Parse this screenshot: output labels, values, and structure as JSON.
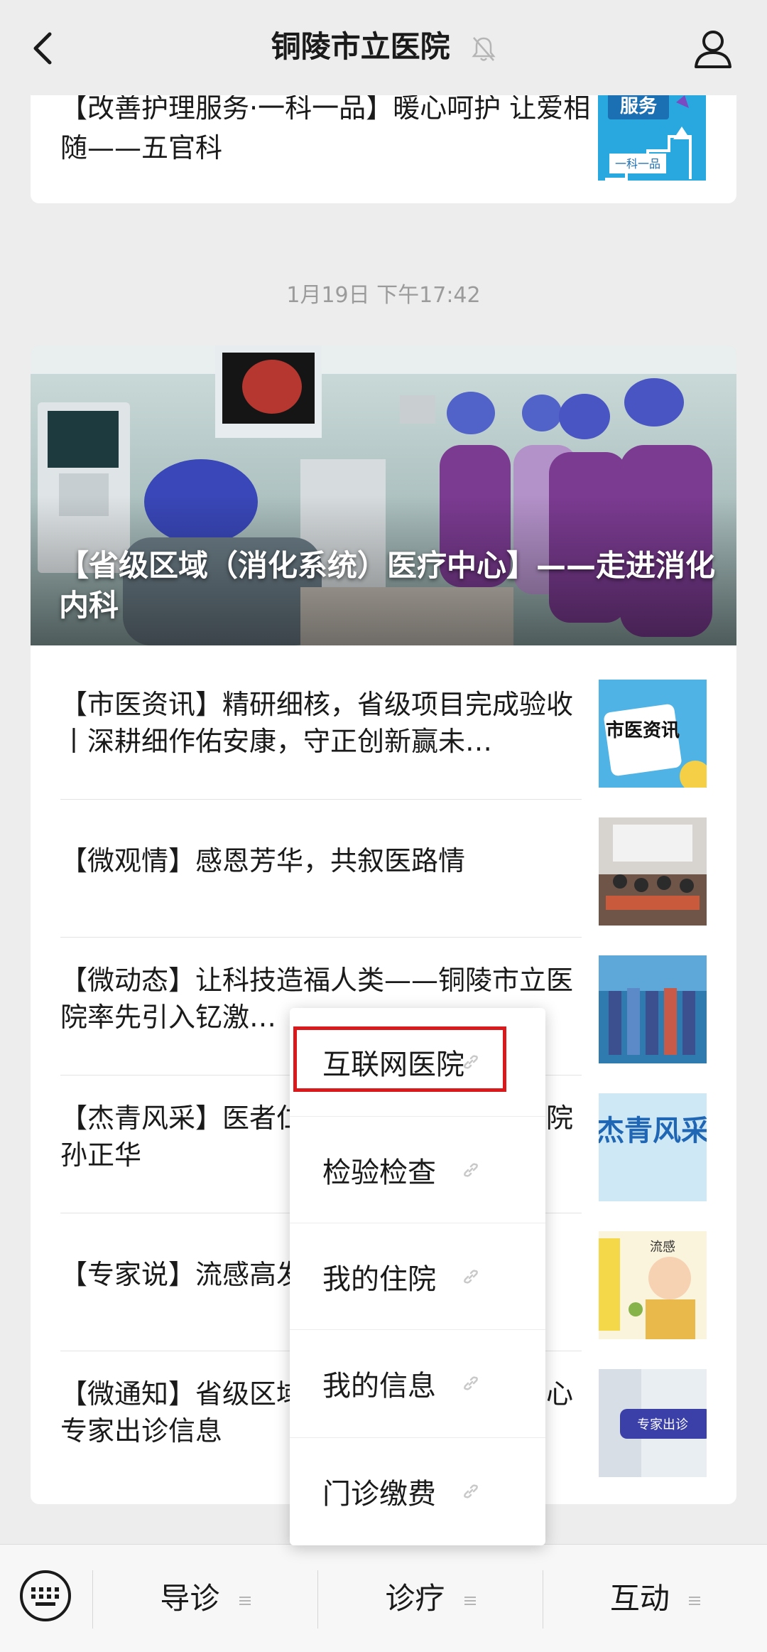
{
  "header": {
    "title": "铜陵市立医院",
    "back_icon": "chevron-left-icon",
    "mute_icon": "bell-off-icon",
    "profile_icon": "person-icon"
  },
  "top_article": {
    "title": "【改善护理服务·一科一品】暖心呵护 让爱相随——五官科",
    "thumb_text_1": "服务",
    "thumb_text_2": "一科一品"
  },
  "timestamp": "1月19日 下午17:42",
  "hero": {
    "title": "【省级区域（消化系统）医疗中心】——走进消化内科"
  },
  "articles": [
    {
      "title": "【市医资讯】精研细核，省级项目完成验收丨深耕细作佑安康，守正创新赢未…",
      "thumb_text": "市医资讯"
    },
    {
      "title": "【微观情】感恩芳华，共叙医路情",
      "thumb_text": ""
    },
    {
      "title": "【微动态】让科技造福人类——铜陵市立医院率先引入钇激…",
      "thumb_text": ""
    },
    {
      "title": "【杰青风采】医者仁心——记铜陵市立医院孙正华",
      "thumb_text": "杰青风采"
    },
    {
      "title": "【专家说】流感高发季，如何科学防护",
      "thumb_text": "流感"
    },
    {
      "title": "【微通知】省级区域（消化系统）医疗中心专家出诊信息",
      "thumb_text": "专家出诊"
    }
  ],
  "menu": {
    "items": [
      {
        "label": "互联网医院"
      },
      {
        "label": "检验检查"
      },
      {
        "label": "我的住院"
      },
      {
        "label": "我的信息"
      },
      {
        "label": "门诊缴费"
      }
    ]
  },
  "bottom_bar": {
    "keyboard_icon": "keyboard-icon",
    "tabs": [
      {
        "label": "导诊"
      },
      {
        "label": "诊疗"
      },
      {
        "label": "互动"
      }
    ]
  },
  "colors": {
    "highlight": "#d9191c",
    "background": "#ededed"
  }
}
